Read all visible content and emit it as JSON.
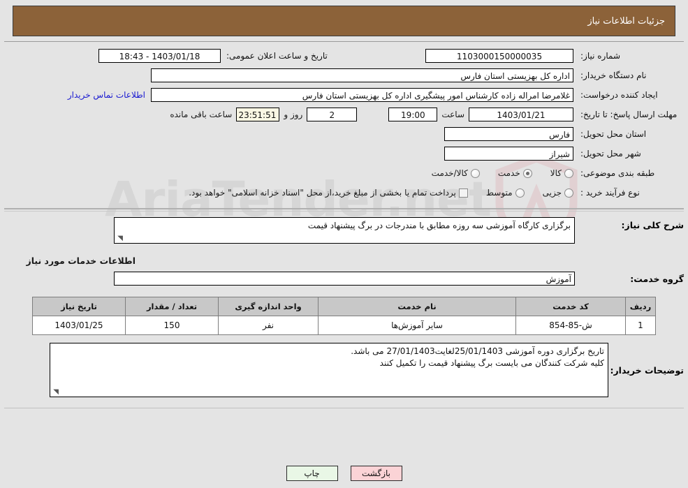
{
  "header": {
    "title": "جزئیات اطلاعات نیاز"
  },
  "watermark": {
    "text": "AriaTender.net"
  },
  "info": {
    "need_number_label": "شماره نیاز:",
    "need_number_value": "1103000150000035",
    "announce_datetime_label": "تاریخ و ساعت اعلان عمومی:",
    "announce_datetime_value": "1403/01/18 - 18:43",
    "buyer_org_label": "نام دستگاه خریدار:",
    "buyer_org_value": "اداره کل بهزیستی استان فارس",
    "requester_label": "ایجاد کننده درخواست:",
    "requester_value": "غلامرضا امراله زاده کارشناس امور پیشگیری اداره کل بهزیستی استان فارس",
    "contact_link": "اطلاعات تماس خریدار",
    "deadline_label": "مهلت ارسال پاسخ: تا تاریخ:",
    "deadline_date": "1403/01/21",
    "deadline_hour_label": "ساعت",
    "deadline_hour": "19:00",
    "remaining_days": "2",
    "days_and_label": "روز و",
    "remaining_time": "23:51:51",
    "remaining_suffix_label": "ساعت باقی مانده",
    "province_label": "استان محل تحویل:",
    "province_value": "فارس",
    "city_label": "شهر محل تحویل:",
    "city_value": "شیراز",
    "category_label": "طبقه بندی موضوعی:",
    "category_options": [
      {
        "label": "کالا",
        "selected": false
      },
      {
        "label": "خدمت",
        "selected": true
      },
      {
        "label": "کالا/خدمت",
        "selected": false
      }
    ],
    "purchase_type_label": "نوع فرآیند خرید :",
    "purchase_type_options": [
      {
        "label": "جزیی",
        "selected": false
      },
      {
        "label": "متوسط",
        "selected": false
      }
    ],
    "treasury_checkbox_label": "پرداخت تمام یا بخشی از مبلغ خرید،از محل \"اسناد خزانه اسلامی\" خواهد بود.",
    "treasury_checked": false
  },
  "need_summary": {
    "label": "شرح کلی نیاز:",
    "value": "برگزاری کارگاه آموزشی سه روزه مطابق با مندرجات در برگ پیشنهاد قیمت"
  },
  "services": {
    "section_title": "اطلاعات خدمات مورد نیاز",
    "group_label": "گروه خدمت:",
    "group_value": "آموزش",
    "table": {
      "columns": [
        "ردیف",
        "کد خدمت",
        "نام خدمت",
        "واحد اندازه گیری",
        "تعداد / مقدار",
        "تاریخ نیاز"
      ],
      "rows": [
        {
          "index": "1",
          "code": "ش-85-854",
          "name": "سایر آموزش‌ها",
          "unit": "نفر",
          "quantity": "150",
          "need_date": "1403/01/25"
        }
      ]
    }
  },
  "buyer_notes": {
    "label": "توضیحات خریدار:",
    "line1": "تاریخ برگزاری دوره آموزشی 25/01/1403لغایت27/01/1403 می باشد.",
    "line2": "کلیه شرکت کنندگان می بایست برگ پیشنهاد قیمت را تکمیل کنند"
  },
  "footer": {
    "print_label": "چاپ",
    "back_label": "بازگشت"
  },
  "colors": {
    "header_bg": "#8c6239",
    "page_bg": "#e4e4e4",
    "link": "#1818d0",
    "back_btn": "#fbd3d6",
    "print_btn": "#e9f7e6",
    "countdown_bg": "#faf7e4"
  }
}
